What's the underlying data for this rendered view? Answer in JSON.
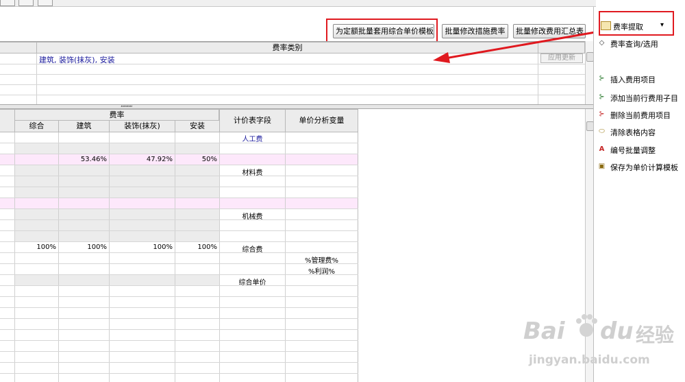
{
  "toolbar_buttons": [
    {
      "label": "为定额批量套用综合单价模板"
    },
    {
      "label": "批量修改措施费率"
    },
    {
      "label": "批量修改费用汇总表"
    }
  ],
  "rate_extract": {
    "label": "费率提取",
    "arrow": "▾"
  },
  "top_grid": {
    "header": "费率类别",
    "row1_value": "建筑, 装饰(抹灰), 安装",
    "apply_button": "应用更新"
  },
  "splitter_grip": ",,,,,,,,,",
  "main_grid": {
    "group_header": "费率",
    "sub_headers": [
      "综合",
      "建筑",
      "装饰(抹灰)",
      "安装"
    ],
    "col_field": "计价表字段",
    "col_var": "单价分析变量",
    "rows": {
      "labor": "人工费",
      "rates": [
        "53.46%",
        "47.92%",
        "50%"
      ],
      "material": "材料费",
      "machine": "机械费",
      "pct_row": [
        "100%",
        "100%",
        "100%",
        "100%"
      ],
      "composite": "综合费",
      "mgmt_var": "%管理费%",
      "profit_var": "%利润%",
      "unit_price": "综合单价"
    }
  },
  "side_menu": [
    {
      "label": "费率查询/选用",
      "icon": "eraser-icon"
    },
    {
      "label": "插入费用项目",
      "icon": "insert-icon"
    },
    {
      "label": "添加当前行费用子目",
      "icon": "add-child-icon"
    },
    {
      "label": "删除当前费用项目",
      "icon": "delete-icon"
    },
    {
      "label": "清除表格内容",
      "icon": "clear-icon"
    },
    {
      "label": "编号批量调整",
      "icon": "renumber-icon"
    },
    {
      "label": "保存为单价计算模板",
      "icon": "save-template-icon"
    }
  ],
  "watermark": {
    "brand": "Bai",
    "du": "du",
    "jy": "经验",
    "url": "jingyan.baidu.com"
  },
  "colors": {
    "red": "#e0191f",
    "pink_row": "#fde8fb",
    "gray_cell": "#ececec",
    "blue_text": "#1a1a9c"
  }
}
